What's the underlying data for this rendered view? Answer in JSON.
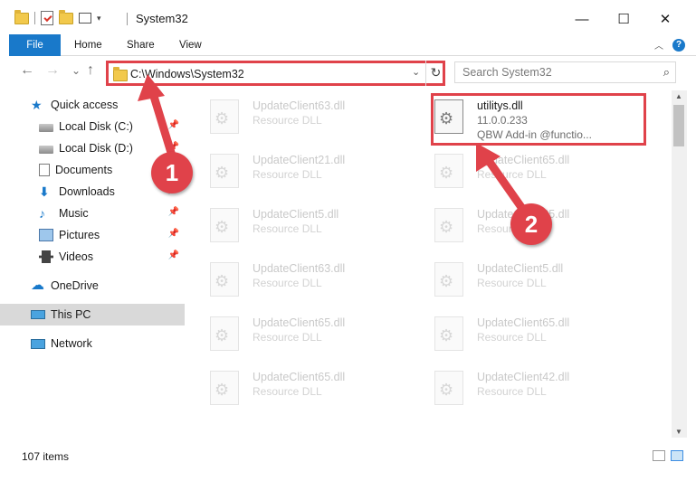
{
  "window": {
    "title": "System32",
    "minimize": "—",
    "maximize": "☐",
    "close": "✕"
  },
  "ribbon": {
    "tabs": [
      "File",
      "Home",
      "Share",
      "View"
    ],
    "help": "?"
  },
  "nav": {
    "back_icon": "←",
    "forward_icon": "→",
    "recent_icon": "⌄",
    "up_icon": "↑",
    "address": "C:\\Windows\\System32",
    "search_placeholder": "Search System32"
  },
  "sidebar": {
    "items": [
      {
        "label": "Quick access",
        "icon": "star-icon"
      },
      {
        "label": "Local Disk (C:)",
        "icon": "disk-icon",
        "pinned": true
      },
      {
        "label": "Local Disk (D:)",
        "icon": "disk-icon",
        "pinned": true
      },
      {
        "label": "Documents",
        "icon": "documents-icon",
        "pinned": true
      },
      {
        "label": "Downloads",
        "icon": "downloads-icon",
        "pinned": true
      },
      {
        "label": "Music",
        "icon": "music-icon",
        "pinned": true
      },
      {
        "label": "Pictures",
        "icon": "pictures-icon",
        "pinned": true
      },
      {
        "label": "Videos",
        "icon": "videos-icon",
        "pinned": true
      },
      {
        "label": "OneDrive",
        "icon": "onedrive-icon"
      },
      {
        "label": "This PC",
        "icon": "this-pc-icon",
        "selected": true
      },
      {
        "label": "Network",
        "icon": "network-icon"
      }
    ]
  },
  "files": {
    "left": [
      {
        "name": "UpdateClient63.dll",
        "type": "Resource DLL"
      },
      {
        "name": "UpdateClient21.dll",
        "type": "Resource DLL"
      },
      {
        "name": "UpdateClient5.dll",
        "type": "Resource DLL"
      },
      {
        "name": "UpdateClient63.dll",
        "type": "Resource DLL"
      },
      {
        "name": "UpdateClient65.dll",
        "type": "Resource DLL"
      },
      {
        "name": "UpdateClient65.dll",
        "type": "Resource DLL"
      }
    ],
    "right": [
      {
        "name": "utilitys.dll",
        "type": "11.0.0.233",
        "desc": "QBW Add-in @functio...",
        "highlighted": true
      },
      {
        "name": "UpdateClient65.dll",
        "type": "Resource DLL"
      },
      {
        "name": "UpdateClient65.dll",
        "type": "Resource DLL"
      },
      {
        "name": "UpdateClient5.dll",
        "type": "Resource DLL"
      },
      {
        "name": "UpdateClient65.dll",
        "type": "Resource DLL"
      },
      {
        "name": "UpdateClient42.dll",
        "type": "Resource DLL"
      }
    ]
  },
  "status": {
    "item_count": "107 items"
  },
  "annotations": {
    "marker_1": "1",
    "marker_2": "2",
    "color": "#e0424a"
  }
}
